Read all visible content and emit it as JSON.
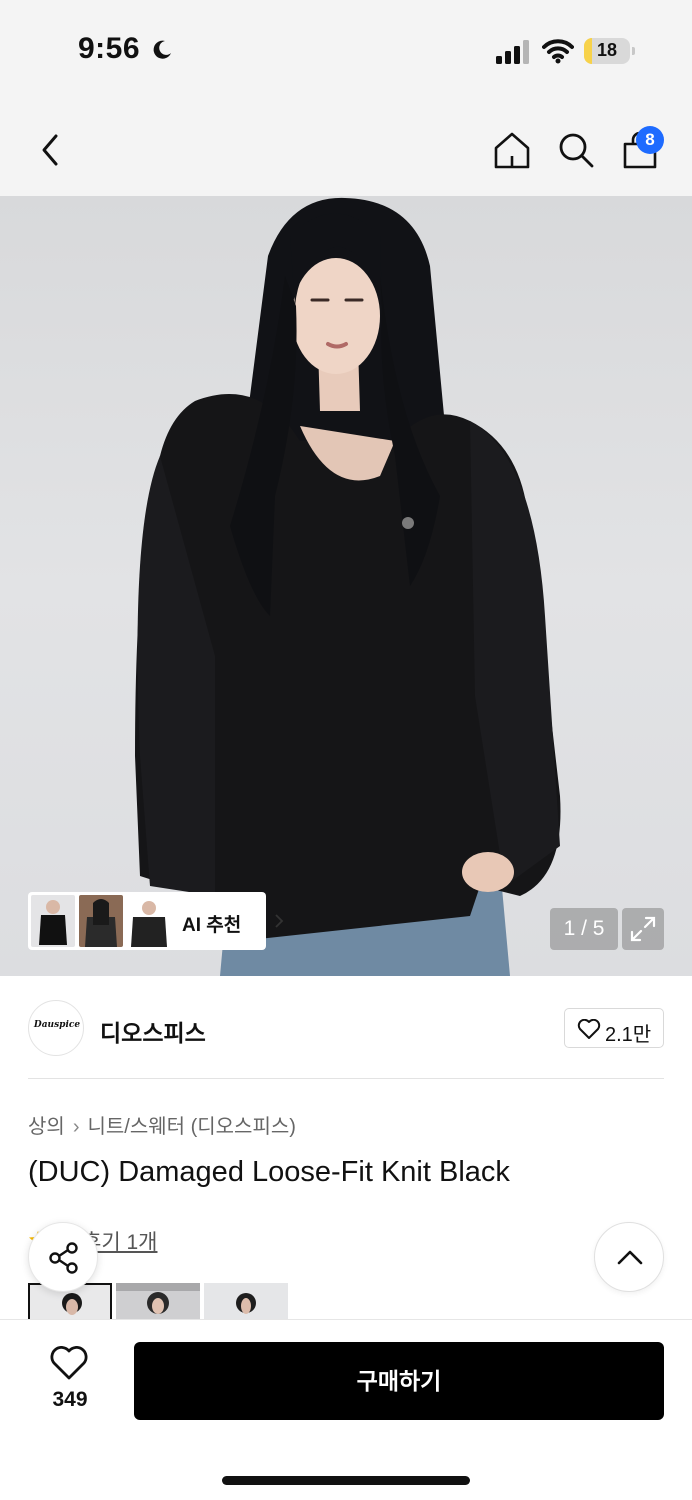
{
  "status_bar": {
    "time": "9:56",
    "battery_level": "18",
    "battery_fraction": 0.18,
    "icons": [
      "moon-icon",
      "signal-icon",
      "wifi-icon",
      "battery-icon"
    ]
  },
  "header": {
    "icons": [
      "back-icon",
      "home-icon",
      "search-icon",
      "cart-icon"
    ],
    "cart_badge": "8",
    "badge_color": "#1e6bff"
  },
  "gallery": {
    "ai_recommend_label": "AI 추천",
    "page_indicator": "1 / 5",
    "icons": [
      "chevron-right-icon",
      "expand-icon"
    ]
  },
  "brand": {
    "logo_text": "Dauspice",
    "name": "디오스피스",
    "like_count": "2.1만"
  },
  "product": {
    "breadcrumb": [
      "상의",
      "니트/스웨터 (디오스피스)"
    ],
    "title": "(DUC) Damaged Loose-Fit Knit Black",
    "review_text": "후기 1개"
  },
  "floating": {
    "icons": [
      "share-icon",
      "chevron-up-icon"
    ]
  },
  "bottom_bar": {
    "wish_count": "349",
    "buy_label": "구매하기",
    "buy_color": "#000000"
  }
}
